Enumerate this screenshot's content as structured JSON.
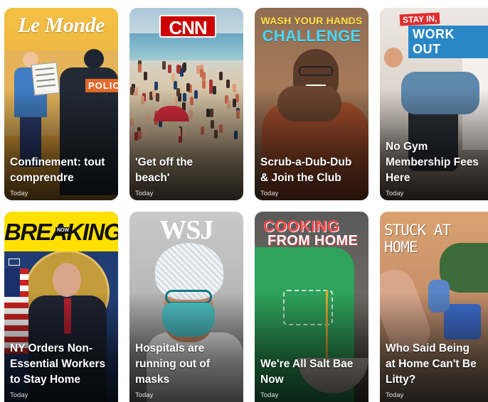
{
  "cards": [
    {
      "id": "lemonde",
      "brand": "Le Monde",
      "badge": "POLICE",
      "title": "Confinement: tout\ncomprendre",
      "date": "Today"
    },
    {
      "id": "cnn",
      "brand": "CNN",
      "title": "'Get off the\nbeach'",
      "date": "Today"
    },
    {
      "id": "washhands",
      "brand_line1": "WASH YOUR HANDS",
      "brand_line2": "CHALLENGE",
      "title": "Scrub-a-Dub-Dub\n& Join the Club",
      "date": "Today"
    },
    {
      "id": "workout",
      "brand_line1": "STAY IN,",
      "brand_line2": "WORK OUT",
      "title": "No Gym\nMembership Fees\nHere",
      "date": "Today"
    },
    {
      "id": "breaking",
      "brand": "BREAKING",
      "brand_tag": "NOW",
      "title": "NY Orders Non-\nEssential Workers\nto Stay Home",
      "date": "Today"
    },
    {
      "id": "wsj",
      "brand": "WSJ",
      "title": "Hospitals are\nrunning out of\nmasks",
      "date": "Today"
    },
    {
      "id": "cooking",
      "brand_line1": "COOKING",
      "brand_line2": "FROM HOME",
      "title": "We're All Salt Bae\nNow",
      "date": "Today"
    },
    {
      "id": "stuckathome",
      "brand": "STUCK AT HOME",
      "title": "Who Said Being\nat Home Can't Be\nLitty?",
      "date": "Today"
    }
  ],
  "colors": {
    "cnn_red": "#cc0000",
    "breaking_yellow": "#ffe000",
    "wash_yellow": "#ffe24a",
    "wash_cyan": "#45d9ff",
    "workout_blue": "#2a87c6",
    "stay_red": "#e02d2d",
    "cooking_red": "#ff4d4d",
    "police_orange": "#e36a2b"
  }
}
